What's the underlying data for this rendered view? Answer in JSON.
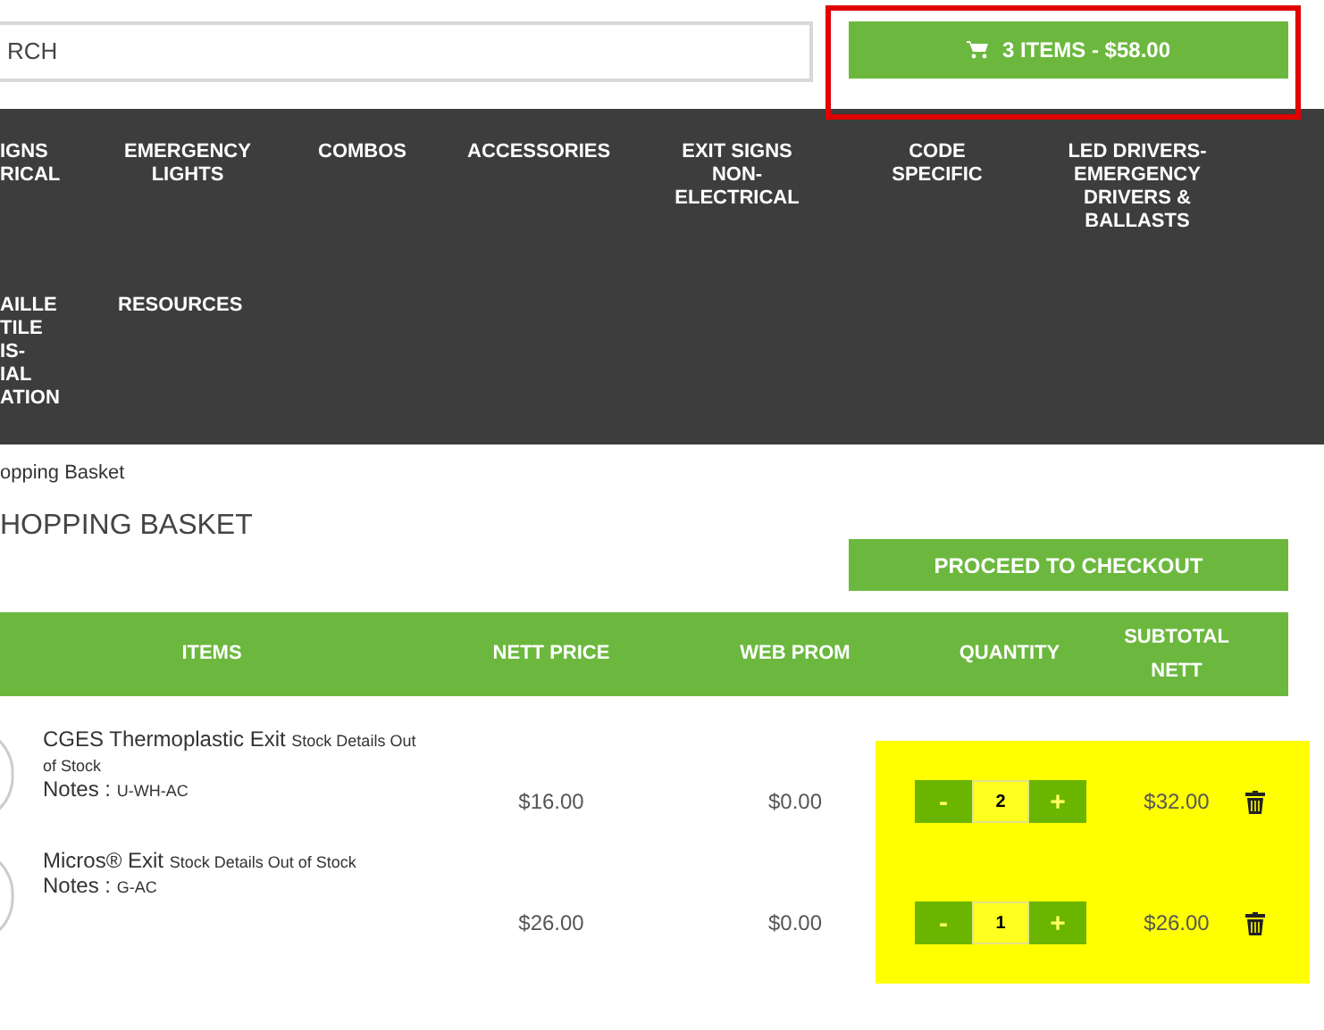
{
  "search": {
    "value": "RCH"
  },
  "cart": {
    "label": "3 ITEMS - $58.00",
    "highlighted": true
  },
  "nav": {
    "rows": [
      [
        "IGNS RICAL",
        "EMERGENCY LIGHTS",
        "COMBOS",
        "ACCESSORIES",
        "EXIT SIGNS NON-ELECTRICAL",
        "CODE SPECIFIC",
        "LED DRIVERS-EMERGENCY DRIVERS & BALLASTS"
      ],
      [
        "AILLE TILE IS- IAL ATION",
        "RESOURCES"
      ]
    ]
  },
  "breadcrumb": "opping Basket",
  "heading": "HOPPING BASKET",
  "checkout_button": "PROCEED TO CHECKOUT",
  "table": {
    "columns": [
      "ITEMS",
      "NETT PRICE",
      "WEB PROM",
      "QUANTITY",
      "SUBTOTAL NETT"
    ],
    "rows": [
      {
        "name": "CGES Thermoplastic Exit",
        "stock": "Stock Details Out of Stock",
        "notes_label": "Notes :",
        "notes": "U-WH-AC",
        "nett_price": "$16.00",
        "web_prom": "$0.00",
        "minus": "-",
        "quantity": "2",
        "plus": "+",
        "subtotal": "$32.00",
        "highlighted": true
      },
      {
        "name": "Micros® Exit",
        "stock": "Stock Details Out of Stock",
        "notes_label": "Notes :",
        "notes": "G-AC",
        "nett_price": "$26.00",
        "web_prom": "$0.00",
        "minus": "-",
        "quantity": "1",
        "plus": "+",
        "subtotal": "$26.00",
        "highlighted": true
      }
    ]
  }
}
